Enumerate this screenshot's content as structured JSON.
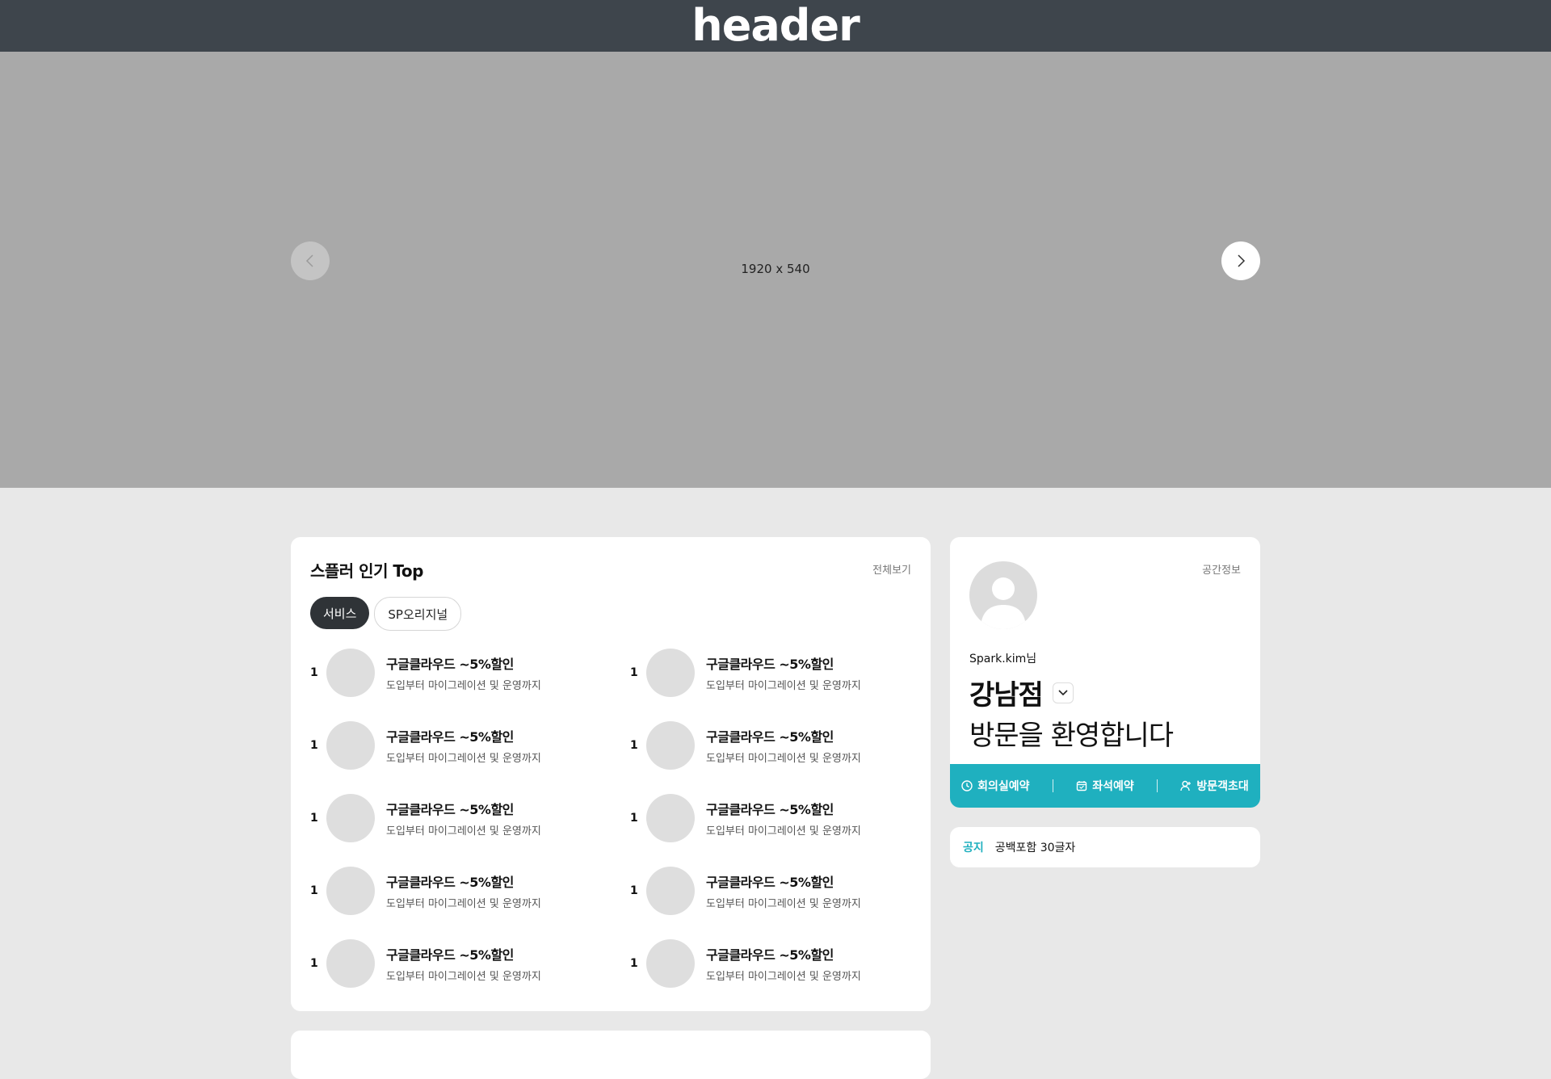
{
  "header": {
    "title": "header"
  },
  "hero": {
    "size_label": "1920 x 540"
  },
  "popular": {
    "title": "스플러 인기 Top",
    "see_all": "전체보기",
    "tabs": [
      {
        "label": "서비스",
        "active": true
      },
      {
        "label": "SP오리지널",
        "active": false
      }
    ],
    "items": [
      {
        "rank": "1",
        "title": "구글클라우드 ~5%할인",
        "subtitle": "도입부터 마이그레이션 및 운영까지"
      },
      {
        "rank": "1",
        "title": "구글클라우드 ~5%할인",
        "subtitle": "도입부터 마이그레이션 및 운영까지"
      },
      {
        "rank": "1",
        "title": "구글클라우드 ~5%할인",
        "subtitle": "도입부터 마이그레이션 및 운영까지"
      },
      {
        "rank": "1",
        "title": "구글클라우드 ~5%할인",
        "subtitle": "도입부터 마이그레이션 및 운영까지"
      },
      {
        "rank": "1",
        "title": "구글클라우드 ~5%할인",
        "subtitle": "도입부터 마이그레이션 및 운영까지"
      },
      {
        "rank": "1",
        "title": "구글클라우드 ~5%할인",
        "subtitle": "도입부터 마이그레이션 및 운영까지"
      },
      {
        "rank": "1",
        "title": "구글클라우드 ~5%할인",
        "subtitle": "도입부터 마이그레이션 및 운영까지"
      },
      {
        "rank": "1",
        "title": "구글클라우드 ~5%할인",
        "subtitle": "도입부터 마이그레이션 및 운영까지"
      },
      {
        "rank": "1",
        "title": "구글클라우드 ~5%할인",
        "subtitle": "도입부터 마이그레이션 및 운영까지"
      },
      {
        "rank": "1",
        "title": "구글클라우드 ~5%할인",
        "subtitle": "도입부터 마이그레이션 및 운영까지"
      }
    ]
  },
  "profile": {
    "space_info": "공간정보",
    "user_name": "Spark.kim님",
    "branch": "강남점",
    "welcome": "방문을 환영합니다",
    "quick_actions": [
      {
        "label": "회의실예약",
        "icon": "clock-icon"
      },
      {
        "label": "좌석예약",
        "icon": "calendar-icon"
      },
      {
        "label": "방문객초대",
        "icon": "person-icon"
      }
    ]
  },
  "notice": {
    "label": "공지",
    "text": "공백포함 30글자"
  },
  "colors": {
    "header_bg": "#3e454c",
    "accent": "#1fb0bf",
    "tab_active": "#2f3337"
  }
}
